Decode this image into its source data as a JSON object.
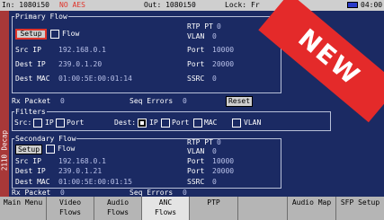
{
  "status_bar": {
    "input": "In: 1080i50",
    "alert": "NO AES",
    "output": "Out: 1080i50",
    "lock": "Lock:",
    "lock_value": "Fr",
    "time": "04:00"
  },
  "side_label": "2110 Decap",
  "primary_flow": {
    "title": "Primary Flow",
    "setup_label": "Setup",
    "flow_label": "Flow",
    "src_ip_label": "Src IP",
    "src_ip": "192.168.0.1",
    "dest_ip_label": "Dest IP",
    "dest_ip": "239.0.1.20",
    "dest_mac_label": "Dest MAC",
    "dest_mac": "01:00:5E:00:01:14",
    "rtp_pt_label": "RTP PT",
    "rtp_pt": "0",
    "vlan_label": "VLAN",
    "vlan": "0",
    "port_label": "Port",
    "src_port": "10000",
    "dest_port": "20000",
    "ssrc_label": "SSRC",
    "ssrc": "0"
  },
  "primary_stats": {
    "rx_label": "Rx Packet",
    "rx": "0",
    "seq_label": "Seq Errors",
    "seq": "0",
    "reset_label": "Reset"
  },
  "filters": {
    "title": "Filters",
    "src_label": "Src:",
    "ip_label": "IP",
    "port_label": "Port",
    "dest_label": "Dest:",
    "mac_label": "MAC",
    "vlan_label": "VLAN"
  },
  "secondary_flow": {
    "title": "Secondary Flow",
    "setup_label": "Setup",
    "flow_label": "Flow",
    "src_ip_label": "Src IP",
    "src_ip": "192.168.0.1",
    "dest_ip_label": "Dest IP",
    "dest_ip": "239.0.1.21",
    "dest_mac_label": "Dest MAC",
    "dest_mac": "01:00:5E:00:01:15",
    "rtp_pt_label": "RTP PT",
    "rtp_pt": "0",
    "vlan_label": "VLAN",
    "vlan": "0",
    "port_label": "Port",
    "src_port": "10000",
    "dest_port": "20000",
    "ssrc_label": "SSRC",
    "ssrc": "0"
  },
  "secondary_stats": {
    "rx_label": "Rx Packet",
    "rx": "0",
    "seq_label": "Seq Errors",
    "seq": "0"
  },
  "tabs": [
    {
      "line1": "Main Menu",
      "line2": ""
    },
    {
      "line1": "Video",
      "line2": "Flows"
    },
    {
      "line1": "Audio",
      "line2": "Flows"
    },
    {
      "line1": "ANC",
      "line2": "Flows"
    },
    {
      "line1": "PTP",
      "line2": ""
    },
    {
      "line1": "",
      "line2": ""
    },
    {
      "line1": "Audio Map",
      "line2": ""
    },
    {
      "line1": "SFP Setup",
      "line2": ""
    }
  ],
  "banner_text": "NEW",
  "colors": {
    "background": "#1b2a63",
    "side_panel": "#a83838",
    "banner": "#e42a2a",
    "alert": "#e0342a"
  }
}
